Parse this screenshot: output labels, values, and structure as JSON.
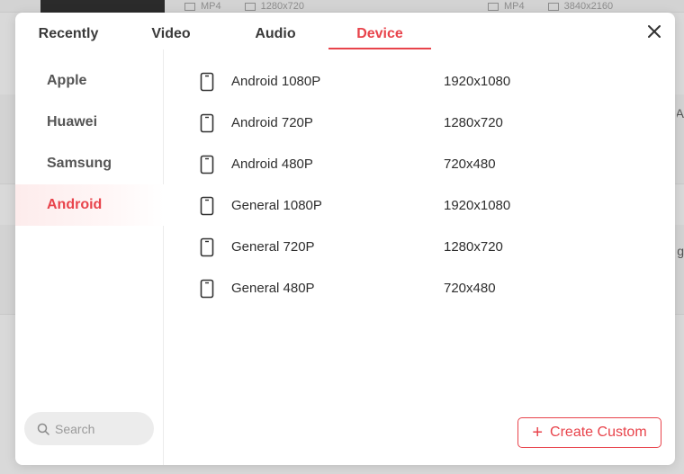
{
  "background": {
    "rows": [
      {
        "meta_left": "MP4",
        "meta_right": "1280x720"
      },
      {
        "meta_left": "MP4",
        "meta_right": "3840x2160"
      }
    ],
    "edge_texts": [
      "CIA",
      "g"
    ]
  },
  "tabs": [
    {
      "label": "Recently"
    },
    {
      "label": "Video"
    },
    {
      "label": "Audio"
    },
    {
      "label": "Device",
      "active": true
    }
  ],
  "close_icon": "close-icon",
  "sidebar": {
    "items": [
      {
        "label": "Apple"
      },
      {
        "label": "Huawei"
      },
      {
        "label": "Samsung"
      },
      {
        "label": "Android",
        "active": true
      }
    ],
    "search": {
      "placeholder": "Search",
      "value": ""
    }
  },
  "presets": [
    {
      "name": "Android 1080P",
      "resolution": "1920x1080",
      "icon": "phone-icon"
    },
    {
      "name": "Android 720P",
      "resolution": "1280x720",
      "icon": "phone-icon"
    },
    {
      "name": "Android 480P",
      "resolution": "720x480",
      "icon": "phone-icon"
    },
    {
      "name": "General 1080P",
      "resolution": "1920x1080",
      "icon": "phone-icon"
    },
    {
      "name": "General 720P",
      "resolution": "1280x720",
      "icon": "phone-icon"
    },
    {
      "name": "General 480P",
      "resolution": "720x480",
      "icon": "phone-icon"
    }
  ],
  "create_button": {
    "label": "Create Custom"
  },
  "colors": {
    "accent": "#e8434b",
    "text": "#2e2e2e",
    "muted": "#9a9a9a"
  }
}
